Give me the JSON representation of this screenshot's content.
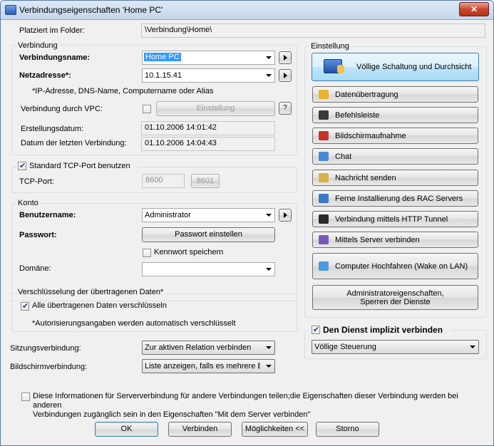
{
  "window": {
    "title": "Verbindungseigenschaften 'Home PC'",
    "close": "✕"
  },
  "folder": {
    "label": "Platziert im Folder:",
    "value": "\\Verbindung\\Home\\"
  },
  "verbindung": {
    "group_title": "Verbindung",
    "name_label": "Verbindungsname:",
    "name_value": "Home PC",
    "address_label": "Netzadresse*:",
    "address_value": "10.1.15.41",
    "address_note": "*IP-Adresse, DNS-Name, Computername oder Alias",
    "vpc_label": "Verbindung durch VPC:",
    "vpc_button": "Einstellung",
    "vpc_help": "?",
    "created_label": "Erstellungsdatum:",
    "created_value": "01.10.2006 14:01:42",
    "last_label": "Datum der letzten Verbindung:",
    "last_value": "01.10.2006 14:04:43"
  },
  "tcp": {
    "checkbox_label": "Standard TCP-Port benutzen",
    "port_label": "TCP-Port:",
    "port_value": "8600",
    "port_value2": "8601"
  },
  "konto": {
    "group_title": "Konto",
    "user_label": "Benutzername:",
    "user_value": "Administrator",
    "password_label": "Passwort:",
    "password_button": "Passwort einstellen",
    "save_label": "Kennwort speichern",
    "domain_label": "Domäne:",
    "domain_value": ""
  },
  "encryption": {
    "group_title": "Verschlüsselung der übertragenen Daten*",
    "checkbox_label": "Alle übertragenen Daten verschlüsseln",
    "note": "*Autorisierungsangaben werden automatisch verschlüsselt"
  },
  "session": {
    "label": "Sitzungsverbindung:",
    "value": "Zur aktiven Relation verbinden"
  },
  "screen": {
    "label": "Bildschirmverbindung:",
    "value": "Liste anzeigen, falls es mehrere Bildschirme gibt"
  },
  "einstellung": {
    "group_title": "Einstellung",
    "main_button": "Völlige Schaltung und Durchsicht",
    "buttons": [
      {
        "label": "Datenübertragung",
        "icon": "folder-transfer-icon",
        "color": "#e8b430"
      },
      {
        "label": "Befehlsleiste",
        "icon": "console-icon",
        "color": "#3a3a3a"
      },
      {
        "label": "Bildschirmaufnahme",
        "icon": "record-icon",
        "color": "#c8342a"
      },
      {
        "label": "Chat",
        "icon": "chat-icon",
        "color": "#4a8ad8"
      },
      {
        "label": "Nachricht senden",
        "icon": "message-icon",
        "color": "#d8b24a"
      },
      {
        "label": "Ferne Installierung des RAC Servers",
        "icon": "install-icon",
        "color": "#3c78c8"
      },
      {
        "label": "Verbindung mittels HTTP Tunnel",
        "icon": "tunnel-icon",
        "color": "#2a2a2a"
      },
      {
        "label": "Mittels Server verbinden",
        "icon": "server-icon",
        "color": "#7a5ab8"
      },
      {
        "label": "Computer Hochfahren (Wake on LAN)",
        "icon": "wake-icon",
        "color": "#4a9ae0"
      }
    ],
    "admin_button_line1": "Administratoreigenschaften,",
    "admin_button_line2": "Sperren der Dienste"
  },
  "implicit": {
    "checkbox_label": "Den Dienst implizit verbinden",
    "value": "Völlige Steuerung"
  },
  "share": {
    "line1": "Diese Informationen für Serververbindung für andere Verbindungen teilen;die Eigenschaften dieser Verbindung werden bei anderen",
    "line2": "Verbindungen zugänglich sein in den Eigenschaften \"Mit dem Server verbinden\""
  },
  "footer": {
    "ok": "OK",
    "connect": "Verbinden",
    "options": "Möglichkeiten <<",
    "cancel": "Storno"
  }
}
